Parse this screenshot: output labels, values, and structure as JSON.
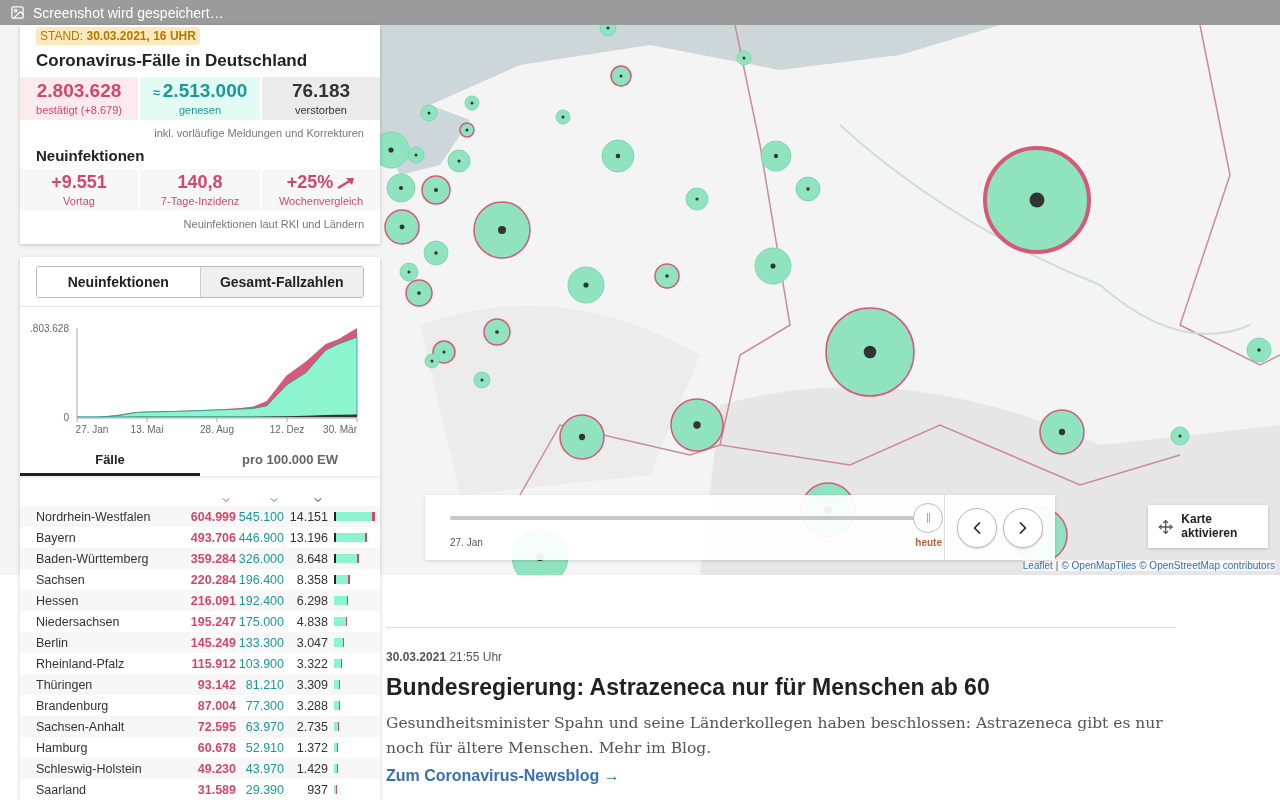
{
  "notification": {
    "text": "Screenshot wird gespeichert…"
  },
  "summary": {
    "stand_label": "STAND:",
    "stand_value": "30.03.2021, 16 UHR",
    "title": "Coronavirus-Fälle in Deutschland",
    "totals": [
      {
        "kind": "confirmed",
        "value": "2.803.628",
        "label": "bestätigt (+8.679)"
      },
      {
        "kind": "recovered",
        "prefix": "≈",
        "value": "2.513.000",
        "label": "genesen"
      },
      {
        "kind": "deceased",
        "value": "76.183",
        "label": "verstorben"
      }
    ],
    "totals_note": "inkl. vorläufige Meldungen und Korrekturen",
    "new_title": "Neuinfektionen",
    "new_cases": [
      {
        "kind": "plain",
        "value": "+9.551",
        "label": "Vortag"
      },
      {
        "kind": "plain",
        "value": "140,8",
        "label": "7-Tage-Inzidenz"
      },
      {
        "kind": "trend",
        "value": "+25%",
        "label": "Wochenvergleich"
      }
    ],
    "new_note": "Neuinfektionen laut RKI und Ländern"
  },
  "mode_tabs": [
    {
      "label": "Neuinfektionen",
      "selected": false
    },
    {
      "label": "Gesamt-Fallzahlen",
      "selected": true
    }
  ],
  "chart": {
    "y_labels": [
      ".803.628",
      "0"
    ],
    "x_labels": [
      "27. Jan",
      "13. Mai",
      "28. Aug",
      "12. Dez",
      "30. Mär"
    ]
  },
  "unit_tabs": [
    {
      "label": "Fälle",
      "selected": true
    },
    {
      "label": "pro 100.000 EW",
      "selected": false
    }
  ],
  "table": {
    "rows": [
      {
        "state": "Nordrhein-Westfalen",
        "confirmed": "604.999",
        "recovered": "545.100",
        "deaths": "14.151"
      },
      {
        "state": "Bayern",
        "confirmed": "493.706",
        "recovered": "446.900",
        "deaths": "13.196"
      },
      {
        "state": "Baden-Württemberg",
        "confirmed": "359.284",
        "recovered": "326.000",
        "deaths": "8.648"
      },
      {
        "state": "Sachsen",
        "confirmed": "220.284",
        "recovered": "196.400",
        "deaths": "8.358"
      },
      {
        "state": "Hessen",
        "confirmed": "216.091",
        "recovered": "192.400",
        "deaths": "6.298"
      },
      {
        "state": "Niedersachsen",
        "confirmed": "195.247",
        "recovered": "175.000",
        "deaths": "4.838"
      },
      {
        "state": "Berlin",
        "confirmed": "145.249",
        "recovered": "133.300",
        "deaths": "3.047"
      },
      {
        "state": "Rheinland-Pfalz",
        "confirmed": "115.912",
        "recovered": "103.900",
        "deaths": "3.322"
      },
      {
        "state": "Thüringen",
        "confirmed": "93.142",
        "recovered": "81.210",
        "deaths": "3.309"
      },
      {
        "state": "Brandenburg",
        "confirmed": "87.004",
        "recovered": "77.300",
        "deaths": "3.288"
      },
      {
        "state": "Sachsen-Anhalt",
        "confirmed": "72.595",
        "recovered": "63.970",
        "deaths": "2.735"
      },
      {
        "state": "Hamburg",
        "confirmed": "60.678",
        "recovered": "52.910",
        "deaths": "1.372"
      },
      {
        "state": "Schleswig-Holstein",
        "confirmed": "49.230",
        "recovered": "43.970",
        "deaths": "1.429"
      },
      {
        "state": "Saarland",
        "confirmed": "31.589",
        "recovered": "29.390",
        "deaths": "937"
      }
    ]
  },
  "timeline": {
    "level": 1,
    "start_label": "27. Jan",
    "end_label": "heute"
  },
  "map_button": {
    "label": "Karte aktivieren"
  },
  "attribution": {
    "links": [
      "Leaflet",
      "© OpenMapTiles",
      "© OpenStreetMap contributors"
    ],
    "separator": "|"
  },
  "article": {
    "date": "30.03.2021",
    "time": "21:55 Uhr",
    "headline": "Bundesregierung: Astrazeneca nur für Menschen ab 60",
    "body": "Gesundheitsminister Spahn und seine Länderkollegen haben beschlossen: Astrazeneca gibt es nur noch für ältere Menschen. Mehr im Blog.",
    "link": "Zum Coronavirus-Newsblog →"
  }
}
